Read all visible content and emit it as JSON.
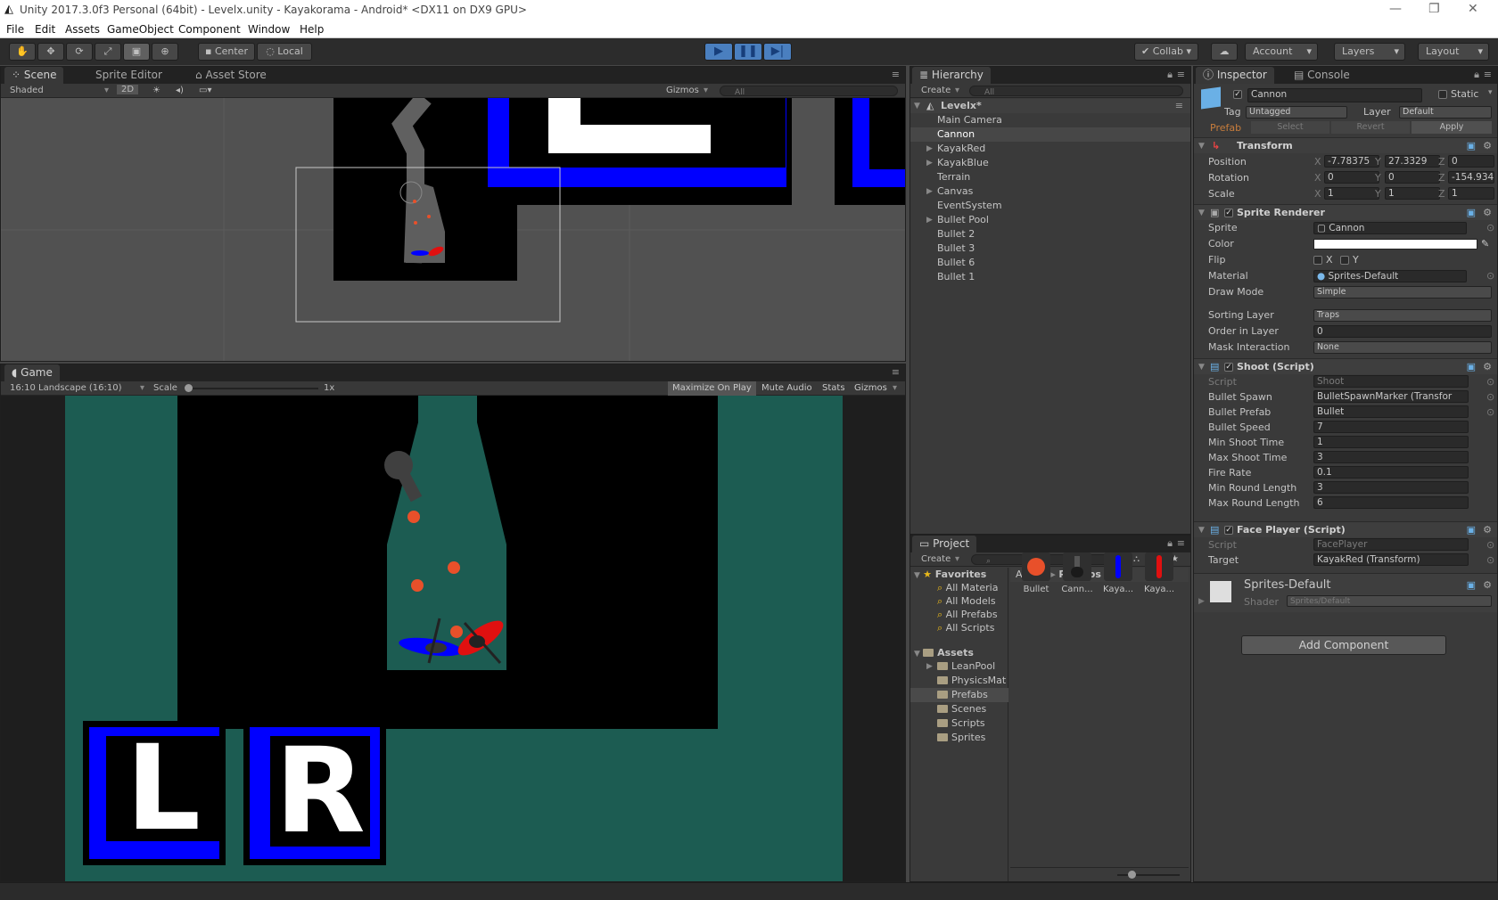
{
  "window": {
    "title": "Unity 2017.3.0f3 Personal (64bit) - Levelx.unity - Kayakorama - Android* <DX11 on DX9 GPU>"
  },
  "menu": [
    "File",
    "Edit",
    "Assets",
    "GameObject",
    "Component",
    "Window",
    "Help"
  ],
  "toolbar": {
    "pivot": "Center",
    "space": "Local",
    "collab": "Collab",
    "account": "Account",
    "layers": "Layers",
    "layout": "Layout"
  },
  "scene": {
    "tabs": [
      "Scene",
      "Sprite Editor",
      "Asset Store"
    ],
    "shading": "Shaded",
    "mode2d": "2D",
    "gizmos": "Gizmos",
    "search": "All"
  },
  "game": {
    "tab": "Game",
    "aspect": "16:10 Landscape (16:10)",
    "scale_label": "Scale",
    "scale_value": "1x",
    "buttons": [
      "Maximize On Play",
      "Mute Audio",
      "Stats",
      "Gizmos"
    ],
    "left_button": "L",
    "right_button": "R"
  },
  "hierarchy": {
    "tab": "Hierarchy",
    "create": "Create",
    "search": "All",
    "scene_name": "Levelx*",
    "items": [
      {
        "label": "Main Camera",
        "arrow": false
      },
      {
        "label": "Cannon",
        "arrow": false,
        "selected": true
      },
      {
        "label": "KayakRed",
        "arrow": true
      },
      {
        "label": "KayakBlue",
        "arrow": true
      },
      {
        "label": "Terrain",
        "arrow": false
      },
      {
        "label": "Canvas",
        "arrow": true
      },
      {
        "label": "EventSystem",
        "arrow": false
      },
      {
        "label": "Bullet Pool",
        "arrow": true
      },
      {
        "label": "Bullet 2",
        "arrow": false
      },
      {
        "label": "Bullet 3",
        "arrow": false
      },
      {
        "label": "Bullet 6",
        "arrow": false
      },
      {
        "label": "Bullet 1",
        "arrow": false
      }
    ]
  },
  "project": {
    "tab": "Project",
    "create": "Create",
    "favorites_label": "Favorites",
    "favorites": [
      "All Materia",
      "All Models",
      "All Prefabs",
      "All Scripts"
    ],
    "assets_label": "Assets",
    "folders": [
      "LeanPool",
      "PhysicsMat",
      "Prefabs",
      "Scenes",
      "Scripts",
      "Sprites"
    ],
    "breadcrumb": [
      "Assets",
      "Prefabs"
    ],
    "prefabs": [
      "Bullet",
      "Cann...",
      "Kaya...",
      "Kaya..."
    ]
  },
  "inspector": {
    "tabs": [
      "Inspector",
      "Console"
    ],
    "object_name": "Cannon",
    "static_label": "Static",
    "tag_label": "Tag",
    "tag": "Untagged",
    "layer_label": "Layer",
    "layer": "Default",
    "prefab_label": "Prefab",
    "prefab_buttons": [
      "Select",
      "Revert",
      "Apply"
    ],
    "transform": {
      "title": "Transform",
      "position_label": "Position",
      "position": [
        "-7.78375",
        "27.3329",
        "0"
      ],
      "rotation_label": "Rotation",
      "rotation": [
        "0",
        "0",
        "-154.934"
      ],
      "scale_label": "Scale",
      "scale": [
        "1",
        "1",
        "1"
      ]
    },
    "sprite_renderer": {
      "title": "Sprite Renderer",
      "rows": [
        {
          "label": "Sprite",
          "value": "Cannon"
        },
        {
          "label": "Color",
          "value": ""
        },
        {
          "label": "Flip",
          "value": ""
        },
        {
          "label": "Material",
          "value": "Sprites-Default"
        },
        {
          "label": "Draw Mode",
          "value": "Simple"
        },
        {
          "label": "Sorting Layer",
          "value": "Traps"
        },
        {
          "label": "Order in Layer",
          "value": "0"
        },
        {
          "label": "Mask Interaction",
          "value": "None"
        }
      ],
      "flip_x": "X",
      "flip_y": "Y"
    },
    "shoot": {
      "title": "Shoot (Script)",
      "rows": [
        {
          "label": "Script",
          "value": "Shoot"
        },
        {
          "label": "Bullet Spawn",
          "value": "BulletSpawnMarker (Transfor"
        },
        {
          "label": "Bullet Prefab",
          "value": "Bullet"
        },
        {
          "label": "Bullet Speed",
          "value": "7"
        },
        {
          "label": "Min Shoot Time",
          "value": "1"
        },
        {
          "label": "Max Shoot Time",
          "value": "3"
        },
        {
          "label": "Fire Rate",
          "value": "0.1"
        },
        {
          "label": "Min Round Length",
          "value": "3"
        },
        {
          "label": "Max Round Length",
          "value": "6"
        }
      ]
    },
    "face_player": {
      "title": "Face Player (Script)",
      "rows": [
        {
          "label": "Script",
          "value": "FacePlayer"
        },
        {
          "label": "Target",
          "value": "KayakRed (Transform)"
        }
      ]
    },
    "material": {
      "name": "Sprites-Default",
      "shader_label": "Shader",
      "shader": "Sprites/Default"
    },
    "add_component": "Add Component"
  },
  "colors": {
    "water": "#1c5c52",
    "wall": "#000000",
    "accent_blue": "#0000ff",
    "bullet": "#e8502a",
    "kayak_red": "#e01010",
    "play": "#4a7fbf"
  }
}
